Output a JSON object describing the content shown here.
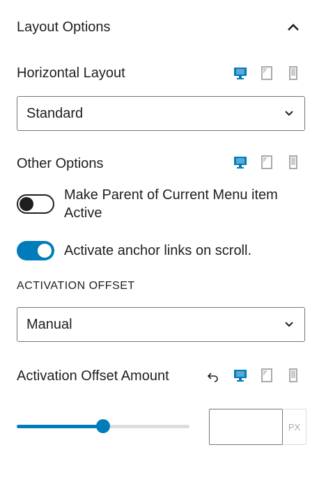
{
  "panel": {
    "title": "Layout Options"
  },
  "horizontal_layout": {
    "label": "Horizontal Layout",
    "value": "Standard"
  },
  "other_options": {
    "label": "Other Options",
    "toggle_parent": {
      "label": "Make Parent of Current Menu item Active",
      "checked": false
    },
    "toggle_anchor": {
      "label": "Activate anchor links on scroll.",
      "checked": true
    }
  },
  "activation_offset": {
    "label": "ACTIVATION OFFSET",
    "value": "Manual"
  },
  "offset_amount": {
    "label": "Activation Offset Amount",
    "slider_fraction": 0.5,
    "input_value": "",
    "unit": "PX"
  },
  "colors": {
    "accent": "#007cba",
    "text": "#1e1e1e",
    "border": "#757575",
    "muted": "#a7aaad"
  },
  "icons": [
    "chevron-up-icon",
    "desktop-icon",
    "tablet-icon",
    "mobile-icon",
    "chevron-down-icon",
    "reset-icon"
  ]
}
